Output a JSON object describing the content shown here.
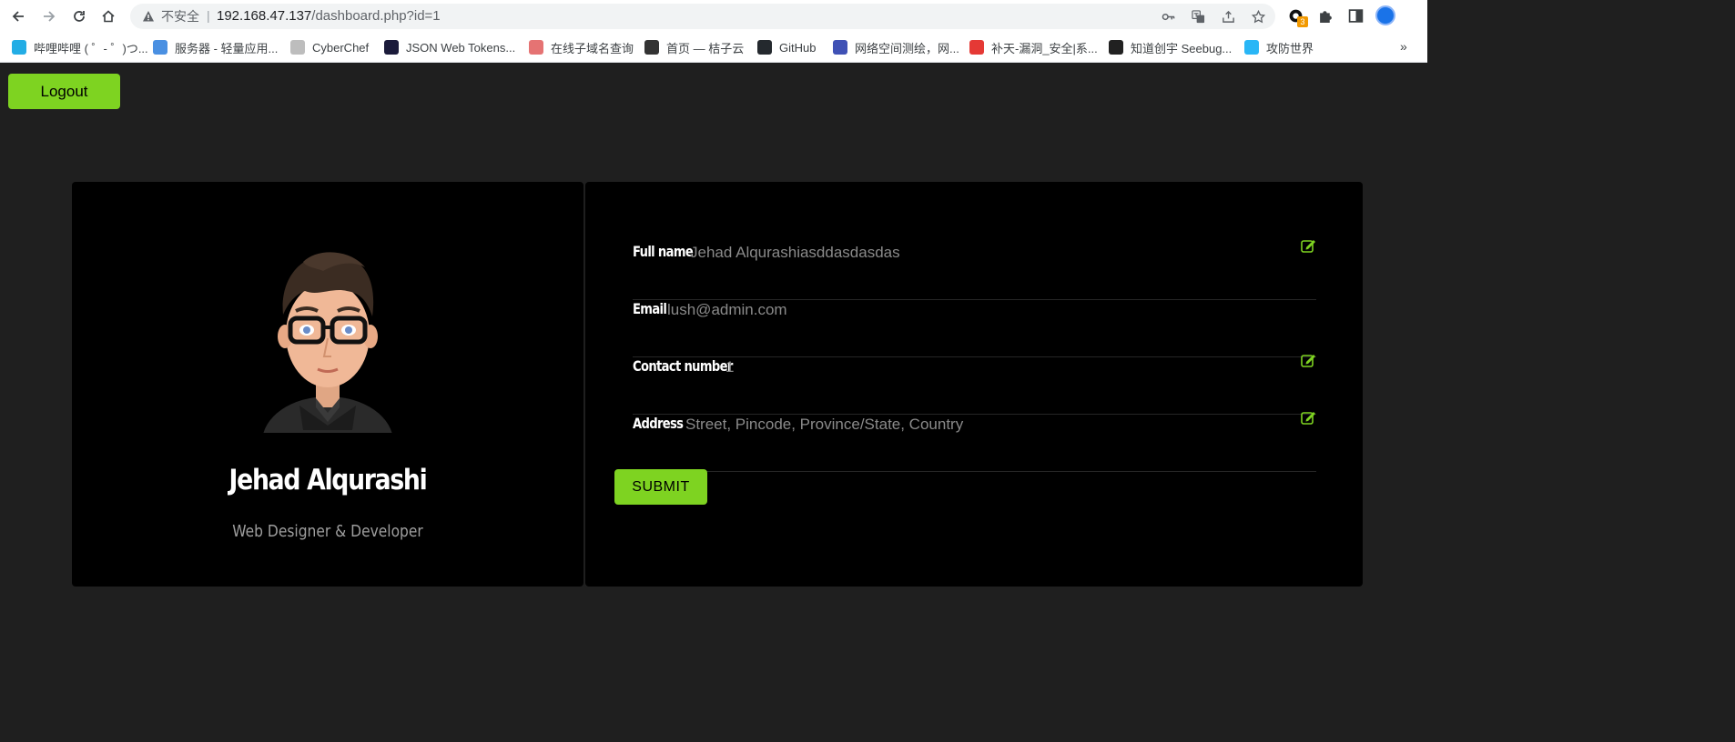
{
  "browser": {
    "security_label": "不安全",
    "separator": "|",
    "url_host": "192.168.47.137",
    "url_path": "/dashboard.php?id=1",
    "extension_badge": "3"
  },
  "bookmarks": [
    {
      "label": "哔哩哔哩 ( ゜- ゜)つ...",
      "color": "#23ade5"
    },
    {
      "label": "服务器 - 轻量应用...",
      "color": "#4a90e2"
    },
    {
      "label": "CyberChef",
      "color": "#bdbdbd"
    },
    {
      "label": "JSON Web Tokens...",
      "color": "#1b1b3a"
    },
    {
      "label": "在线子域名查询",
      "color": "#e57373"
    },
    {
      "label": "首页 — 桔子云",
      "color": "#333333"
    },
    {
      "label": "GitHub",
      "color": "#24292e"
    },
    {
      "label": "网络空间测绘，网...",
      "color": "#3f51b5"
    },
    {
      "label": "补天-漏洞_安全|系...",
      "color": "#e53935"
    },
    {
      "label": "知道创宇 Seebug...",
      "color": "#212121"
    },
    {
      "label": "攻防世界",
      "color": "#29b6f6"
    }
  ],
  "page": {
    "logout_label": "Logout",
    "profile": {
      "name": "Jehad Alqurashi",
      "role": "Web Designer & Developer"
    },
    "fields": [
      {
        "label": "Full name",
        "value": "Jehad Alqurashiasddasdasdas",
        "editable": true
      },
      {
        "label": "Email",
        "value": "lush@admin.com",
        "editable": false
      },
      {
        "label": "Contact number",
        "value": "1",
        "editable": true
      },
      {
        "label": "Address",
        "value": "Street, Pincode, Province/State, Country",
        "editable": true
      }
    ],
    "submit_label": "SUBMIT",
    "accent_color": "#7ed321"
  }
}
